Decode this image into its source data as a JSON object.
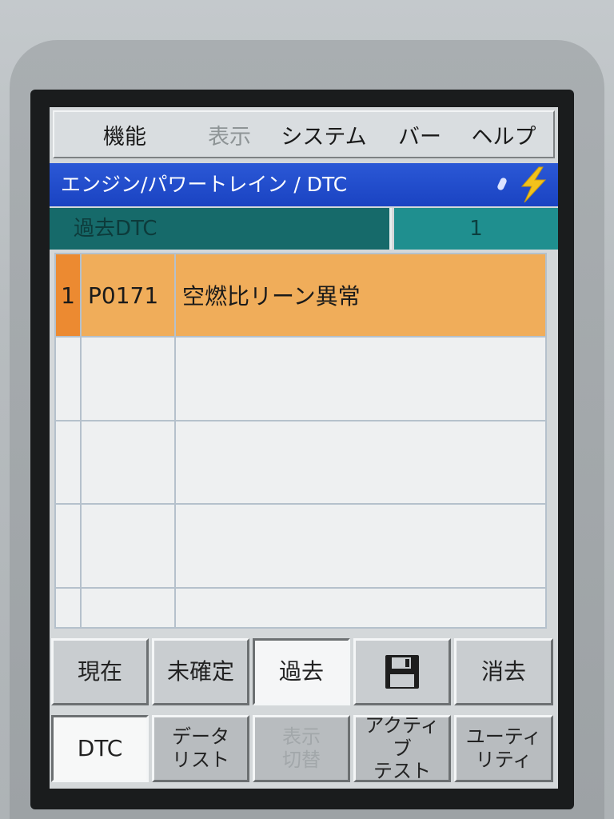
{
  "menu": {
    "items": [
      {
        "label": "機能",
        "enabled": true
      },
      {
        "label": "表示",
        "enabled": false
      },
      {
        "label": "システム",
        "enabled": true
      },
      {
        "label": "バー",
        "enabled": true
      },
      {
        "label": "ヘルプ",
        "enabled": true
      }
    ]
  },
  "titlebar": {
    "breadcrumb": "エンジン/パワートレイン / DTC",
    "status_icon": "lightning-bolt-icon"
  },
  "status": {
    "label": "過去DTC",
    "count": "1"
  },
  "table": {
    "rows": [
      {
        "num": "1",
        "code": "P0171",
        "desc": "空燃比リーン異常",
        "selected": true
      },
      {
        "num": "",
        "code": "",
        "desc": "",
        "selected": false
      },
      {
        "num": "",
        "code": "",
        "desc": "",
        "selected": false
      },
      {
        "num": "",
        "code": "",
        "desc": "",
        "selected": false
      },
      {
        "num": "",
        "code": "",
        "desc": "",
        "selected": false
      }
    ]
  },
  "filters": {
    "current": "現在",
    "pending": "未確定",
    "history": "過去",
    "save_icon": "floppy-disk-icon",
    "clear": "消去"
  },
  "tabs": {
    "dtc": "DTC",
    "datalist_1": "データ",
    "datalist_2": "リスト",
    "display_1": "表示",
    "display_2": "切替",
    "active_1": "アクティブ",
    "active_2": "テスト",
    "utility_1": "ユーティ",
    "utility_2": "リティ"
  },
  "colors": {
    "title_blue": "#1a43c2",
    "status_teal": "#166a6a",
    "selected_row": "#f0ad5a",
    "selected_num": "#ec8a31",
    "bolt_yellow": "#f2c21b"
  }
}
